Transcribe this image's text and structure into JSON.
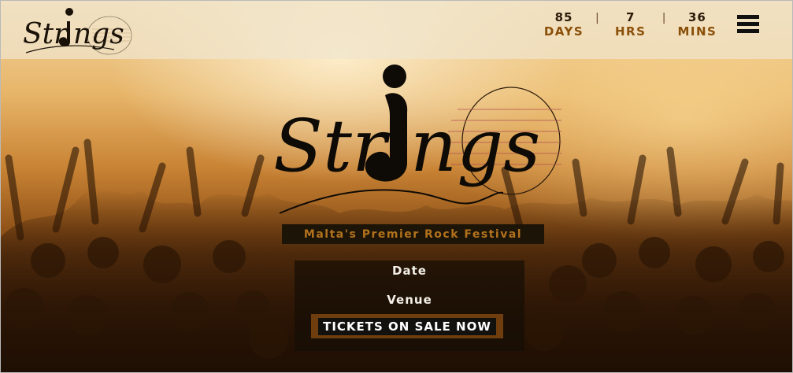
{
  "brand": {
    "name": "Strings"
  },
  "countdown": [
    {
      "value": "85",
      "label": "DAYS"
    },
    {
      "value": "7",
      "label": "HRS"
    },
    {
      "value": "36",
      "label": "MINS"
    }
  ],
  "countdown_separator": "|",
  "hero": {
    "tagline": "Malta's Premier Rock Festival",
    "date_label": "Date",
    "venue_label": "Venue",
    "tickets_label": "TICKETS ON SALE NOW"
  },
  "colors": {
    "accent": "#8a4f08",
    "tagline_text": "#b2721c",
    "tagline_bg": "#1d1408",
    "tickets_border": "#6f3d0e"
  },
  "icons": {
    "menu": "hamburger-menu-icon"
  }
}
